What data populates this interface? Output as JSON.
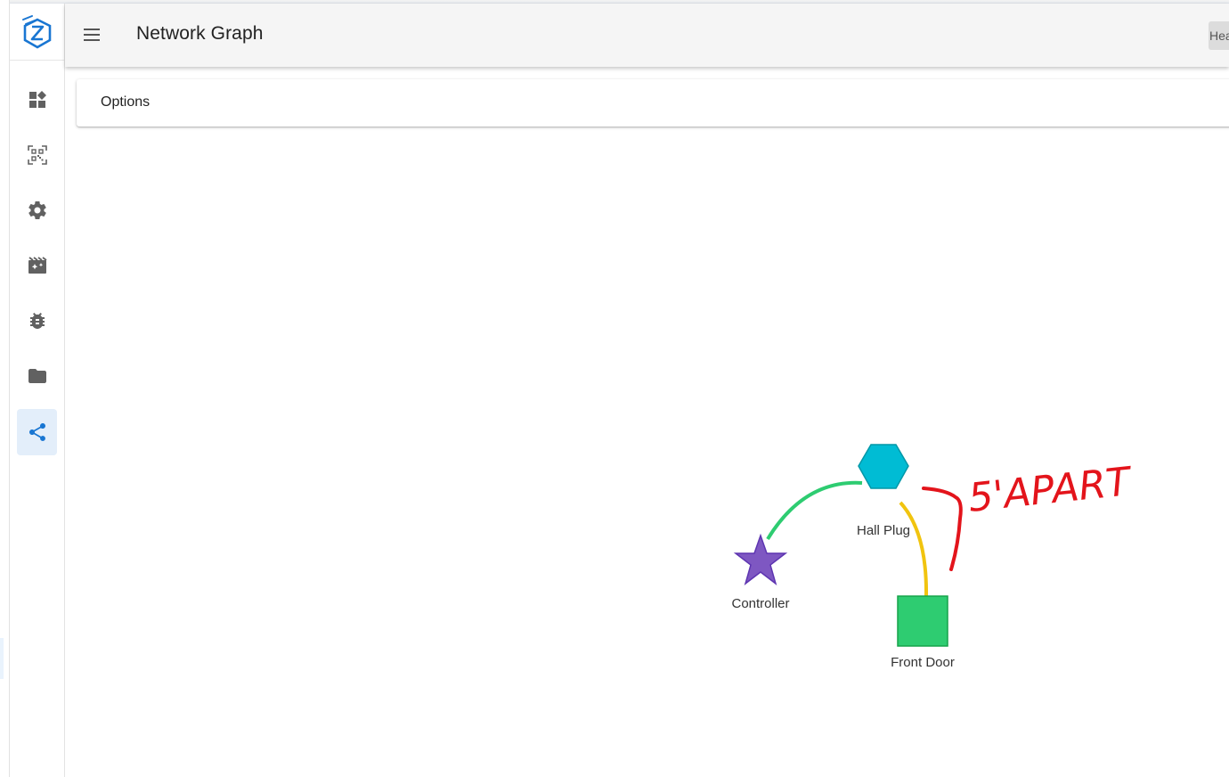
{
  "app": {
    "title": "Network Graph",
    "header_button_label": "Hea"
  },
  "sidebar": {
    "items": [
      {
        "icon": "dashboard-icon",
        "label": ""
      },
      {
        "icon": "qr-scan-icon",
        "label": ""
      },
      {
        "icon": "gear-icon",
        "label": ""
      },
      {
        "icon": "movie-scenes-icon",
        "label": ""
      },
      {
        "icon": "bug-icon",
        "label": ""
      },
      {
        "icon": "folder-icon",
        "label": ""
      },
      {
        "icon": "share-network-icon",
        "label": "",
        "active": true
      }
    ]
  },
  "options": {
    "label": "Options"
  },
  "graph": {
    "nodes": [
      {
        "id": "controller",
        "label": "Controller",
        "shape": "star",
        "color": "#7e57c2"
      },
      {
        "id": "hall-plug",
        "label": "Hall Plug",
        "shape": "hexagon",
        "color": "#00bcd4"
      },
      {
        "id": "front-door",
        "label": "Front Door",
        "shape": "square",
        "color": "#2ecc71"
      }
    ],
    "links": [
      {
        "from": "controller",
        "to": "hall-plug",
        "color": "#2ecc71"
      },
      {
        "from": "hall-plug",
        "to": "front-door",
        "color": "#f1c40f"
      }
    ]
  },
  "annotation": {
    "text": "5'APART",
    "color": "#e3141b"
  },
  "colors": {
    "accent": "#1976d2",
    "active_nav_bg": "#e3eefa",
    "icon_gray": "#616161"
  }
}
